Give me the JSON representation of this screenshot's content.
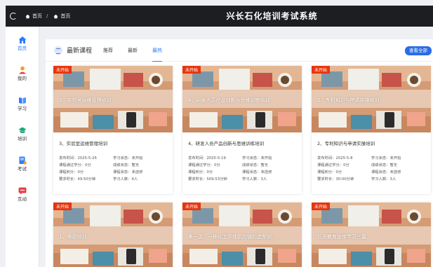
{
  "app": {
    "title": "兴长石化培训考试系统",
    "breadcrumb": [
      "首页",
      "首页"
    ]
  },
  "sidebar": {
    "items": [
      {
        "label": "首页",
        "icon": "home-icon",
        "color": "#2f7cf6",
        "active": true
      },
      {
        "label": "我的",
        "icon": "user-icon",
        "color": "#f0a020",
        "active": false
      },
      {
        "label": "学习",
        "icon": "book-icon",
        "color": "#2f7cf6",
        "active": false
      },
      {
        "label": "培训",
        "icon": "graduation-cap-icon",
        "color": "#1aa87c",
        "active": false
      },
      {
        "label": "考试",
        "icon": "exam-icon",
        "color": "#2f7cf6",
        "active": false
      },
      {
        "label": "互动",
        "icon": "chat-icon",
        "color": "#e8404a",
        "active": false
      }
    ]
  },
  "main": {
    "header": "最新课程",
    "tabs": [
      "推荐",
      "最新",
      "最热"
    ],
    "active_tab": 2,
    "view_all": "查看全部",
    "badge": "未开始",
    "accent": "#2f7cf6",
    "cards": [
      {
        "thumb_title": "3、实验室运维管理培训",
        "title": "3、实验室运维管理培训",
        "info": [
          "发布时间：2025-5-26",
          "学习状态：未开始",
          "课程通过学分：0分",
          "成绩状态：暂无",
          "课程积分：0分",
          "课程状态：未选修",
          "要求时长：49:50分钟",
          "学习人数：4人"
        ]
      },
      {
        "thumb_title": "4、研发人员产品创新与思维训练培训",
        "title": "4、研发人员产品创新与思维训练培训",
        "info": [
          "发布时间：2025-5-19",
          "学习状态：未开始",
          "课程通过学分：0分",
          "成绩状态：暂无",
          "课程积分：0分",
          "课程状态：未选修",
          "要求时长：509:53分钟",
          "学习人数：3人"
        ]
      },
      {
        "thumb_title": "2、专利知识与申请实操培训",
        "title": "2、专利知识与申请实操培训",
        "info": [
          "发布时间：2025-5-8",
          "学习状态：未开始",
          "课程通过学分：0分",
          "成绩状态：暂无",
          "课程积分：0分",
          "课程状态：未选修",
          "要求时长：30:00分钟",
          "学习人数：3人"
        ]
      },
      {
        "thumb_title": "1、保密培训",
        "title": "",
        "info": []
      },
      {
        "thumb_title": "第一讲：一种化工中体供应链的选型创...",
        "title": "",
        "info": []
      },
      {
        "thumb_title": "反恐教育宣传学习三要",
        "title": "",
        "info": []
      }
    ]
  }
}
